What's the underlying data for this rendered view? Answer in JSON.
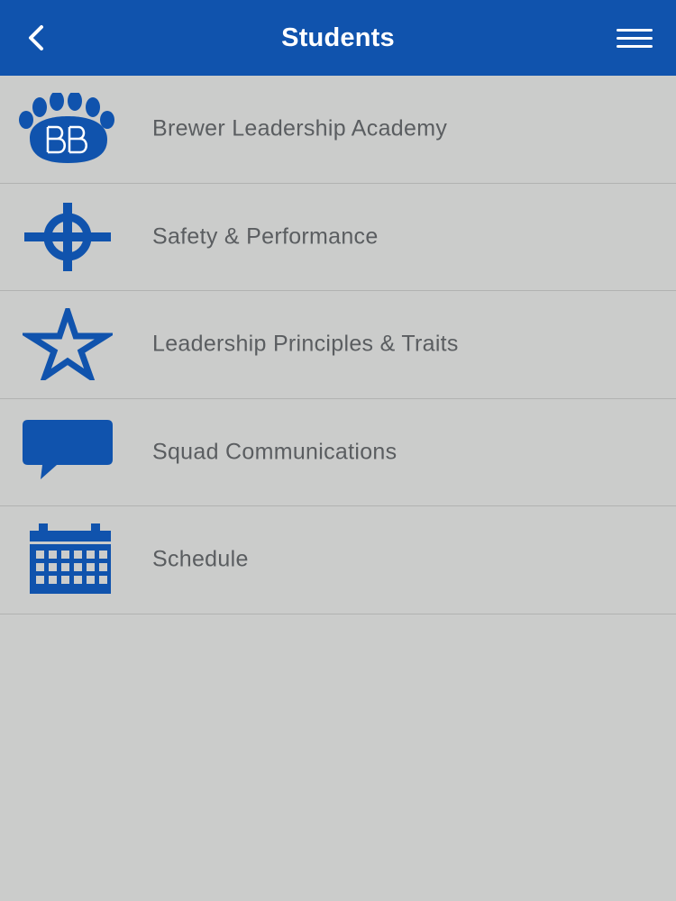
{
  "header": {
    "title": "Students",
    "back_icon": "chevron-left-icon",
    "menu_icon": "hamburger-menu-icon"
  },
  "colors": {
    "header_bg": "#1053ad",
    "icon_blue": "#1053ad",
    "list_bg": "#cbcccb",
    "label_text": "#5a5d60",
    "divider": "#b1b2b1"
  },
  "menu": {
    "items": [
      {
        "label": "Brewer Leadership Academy",
        "icon": "bear-paw-logo-icon"
      },
      {
        "label": "Safety & Performance",
        "icon": "crosshair-icon"
      },
      {
        "label": "Leadership Principles & Traits",
        "icon": "star-icon"
      },
      {
        "label": "Squad Communications",
        "icon": "speech-bubble-icon"
      },
      {
        "label": "Schedule",
        "icon": "calendar-icon"
      }
    ]
  }
}
